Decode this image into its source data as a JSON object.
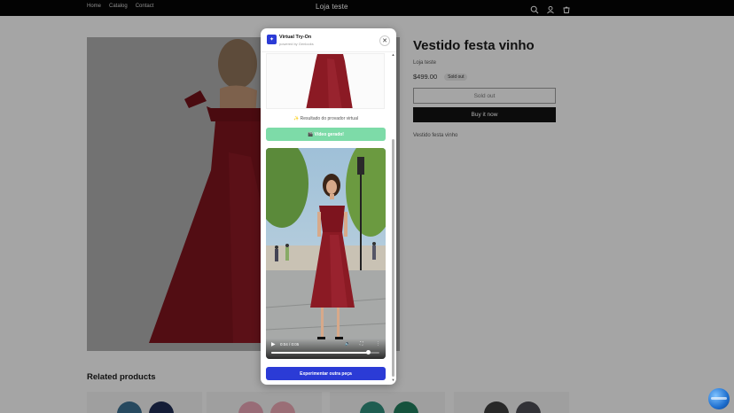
{
  "header": {
    "nav": [
      "Home",
      "Catalog",
      "Contact"
    ],
    "store_name": "Loja teste",
    "icons": [
      "search-icon",
      "account-icon",
      "cart-icon"
    ]
  },
  "product": {
    "title": "Vestido festa vinho",
    "vendor": "Loja teste",
    "price": "$499.00",
    "badge": "Sold out",
    "soldout_label": "Sold out",
    "buy_label": "Buy it now",
    "description": "Vestido festa vinho"
  },
  "related": {
    "title": "Related products"
  },
  "modal": {
    "title": "Virtual Try-On",
    "subtitle": "powered by Genlooks",
    "result_label": "✨ Resultado do provador virtual",
    "video_button": "🎬 Vídeo gerado!",
    "video": {
      "time": "0:04 / 0:05",
      "progress": 0.9
    },
    "try_button": "Experimentar outra peça"
  },
  "colors": {
    "accent": "#2b3bd6",
    "success": "#7ddba8",
    "dress": "#8b1a24"
  }
}
